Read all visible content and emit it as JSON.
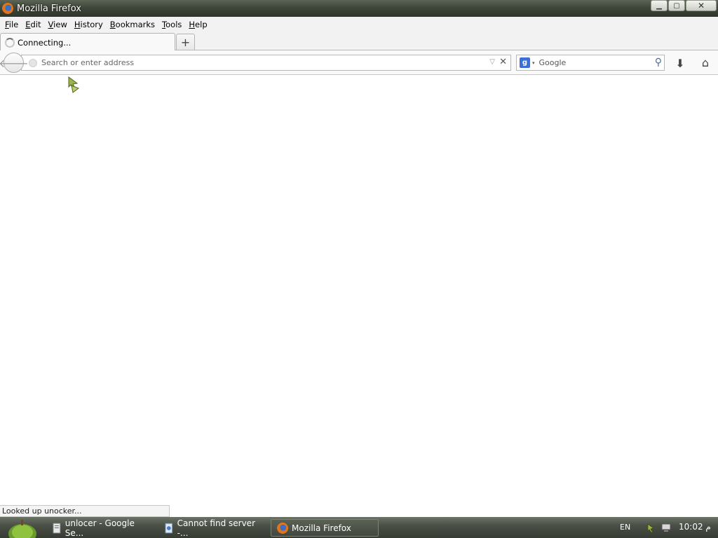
{
  "window": {
    "title": "Mozilla Firefox"
  },
  "window_buttons": {
    "minimize": "▁",
    "maximize": "▢",
    "close": "✕"
  },
  "menu": {
    "items": [
      {
        "label": "File",
        "accel": "F",
        "rest": "ile"
      },
      {
        "label": "Edit",
        "accel": "E",
        "rest": "dit"
      },
      {
        "label": "View",
        "accel": "V",
        "rest": "iew"
      },
      {
        "label": "History",
        "accel": "H",
        "rest": "istory"
      },
      {
        "label": "Bookmarks",
        "accel": "B",
        "rest": "ookmarks"
      },
      {
        "label": "Tools",
        "accel": "T",
        "rest": "ools"
      },
      {
        "label": "Help",
        "accel": "H",
        "rest": "elp"
      }
    ]
  },
  "tabs": {
    "active_label": "Connecting...",
    "new_tab_label": "+"
  },
  "nav": {
    "back_icon": "🡐",
    "url_placeholder": "Search or enter address",
    "url_value": "",
    "dropmarker": "▽",
    "stop_icon": "✕",
    "search_engine_letter": "g",
    "search_engine_arrow": "▾",
    "search_placeholder": "Google",
    "search_go_icon": "⚲",
    "download_icon": "⬇",
    "home_icon": "⌂"
  },
  "status": {
    "text": "Looked up unocker..."
  },
  "taskbar": {
    "tasks": [
      {
        "label": "unlocer - Google Se...",
        "active": false
      },
      {
        "label": "Cannot find server -...",
        "active": false
      },
      {
        "label": "Mozilla Firefox",
        "active": true
      }
    ],
    "language": "EN",
    "clock": "10:02 م"
  },
  "colors": {
    "titlebar": "#3f463a",
    "taskbar": "#4a5046",
    "chrome_bg": "#f2f2f2",
    "accent_search": "#3a6fd8"
  }
}
